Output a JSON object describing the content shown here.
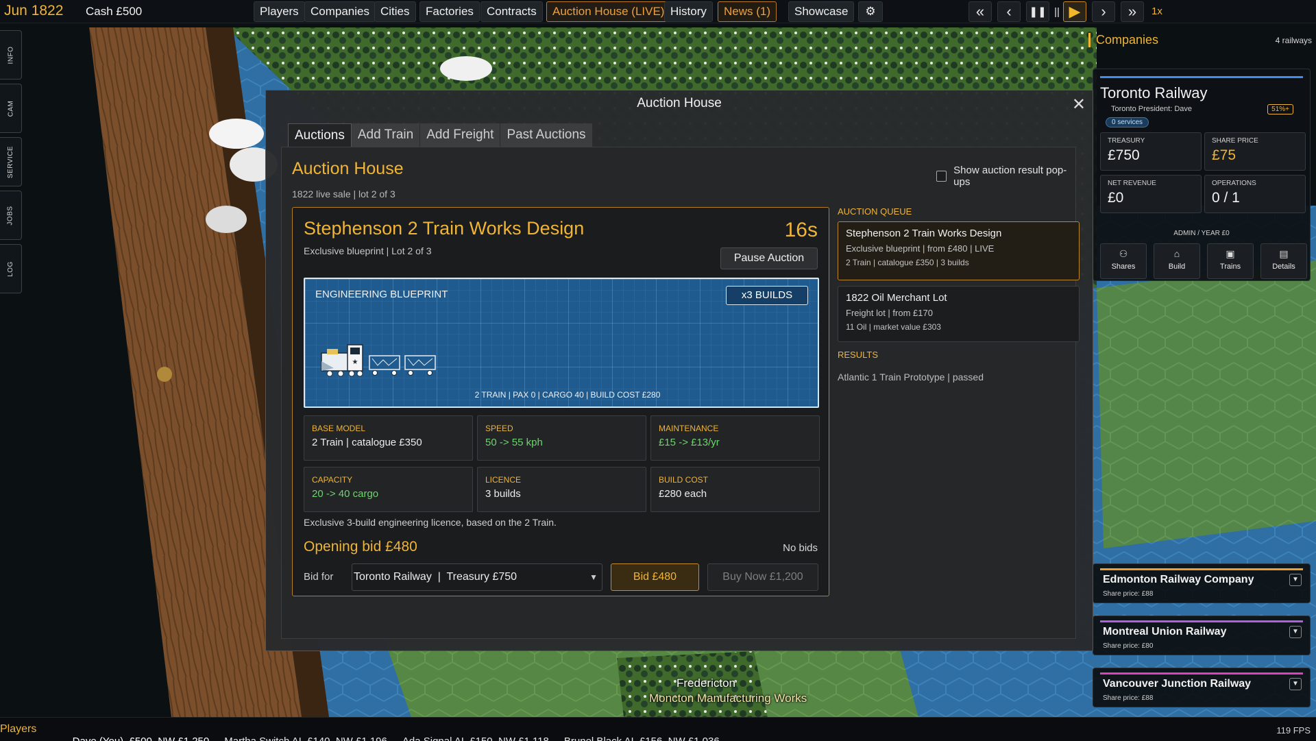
{
  "topbar": {
    "date": "Jun 1822",
    "cash": "Cash £500",
    "menu": [
      "Players",
      "Companies",
      "Cities",
      "Factories",
      "Contracts",
      "Auction House (LIVE)",
      "History",
      "News (1)",
      "Showcase"
    ],
    "speed": "1x"
  },
  "left_tabs": [
    "INFO",
    "CAM",
    "SERVICE",
    "JOBS",
    "LOG"
  ],
  "map_labels": {
    "city": "Fredericton",
    "works": "Moncton Manufacturing Works"
  },
  "modal": {
    "title": "Auction House",
    "close": "✕",
    "tabs": [
      "Auctions",
      "Add Train",
      "Add Freight",
      "Past Auctions"
    ],
    "heading": "Auction House",
    "subheading": "1822 live sale | lot 2 of 3",
    "popup_toggle_label": "Show auction result pop-ups",
    "lot": {
      "name": "Stephenson 2 Train Works Design",
      "meta": "Exclusive blueprint | Lot 2 of 3",
      "timer": "16s",
      "pause_label": "Pause Auction",
      "blueprint_label": "ENGINEERING BLUEPRINT",
      "builds_badge": "x3 BUILDS",
      "blueprint_stats": "2 TRAIN | PAX 0 | CARGO 40 | BUILD COST £280",
      "stats": [
        {
          "key": "Base Model",
          "value": "2 Train | catalogue £350",
          "green": false
        },
        {
          "key": "Speed",
          "value": "50 -> 55 kph",
          "green": true
        },
        {
          "key": "Maintenance",
          "value": "£15 -> £13/yr",
          "green": true
        },
        {
          "key": "Capacity",
          "value": "20 -> 40 cargo",
          "green": true
        },
        {
          "key": "Licence",
          "value": "3 builds",
          "green": false
        },
        {
          "key": "Build Cost",
          "value": "£280 each",
          "green": false
        }
      ],
      "description": "Exclusive 3-build engineering licence, based on the 2 Train.",
      "opening_bid": "Opening bid £480",
      "bids_status": "No bids",
      "bid_for_label": "Bid for",
      "bid_for_value": "Toronto Railway  |  Treasury £750",
      "bid_button": "Bid £480",
      "buy_now_button": "Buy Now £1,200"
    },
    "queue_label": "AUCTION QUEUE",
    "queue": [
      {
        "title": "Stephenson 2 Train Works Design",
        "line1": "Exclusive blueprint | from £480 | LIVE",
        "line2": "2 Train | catalogue £350 | 3 builds",
        "active": true
      },
      {
        "title": "1822 Oil Merchant Lot",
        "line1": "Freight lot | from £170",
        "line2": "11 Oil | market value £303",
        "active": false
      }
    ],
    "results_label": "RESULTS",
    "results": [
      "Atlantic 1 Train Prototype | passed"
    ]
  },
  "companies": {
    "heading": "Companies",
    "count": "4 railways",
    "selected": {
      "name": "Toronto Railway",
      "sub": "Toronto  President: Dave",
      "badge": "51%+",
      "services": "0 services",
      "treasury_label": "Treasury",
      "treasury": "£750",
      "share_price_label": "Share Price",
      "share_price": "£75",
      "net_revenue_label": "Net Revenue",
      "net_revenue": "£0",
      "operations_label": "Operations",
      "operations": "0 / 1",
      "admin": "ADMIN / YEAR   £0",
      "actions": [
        "Shares",
        "Build",
        "Trains",
        "Details"
      ]
    },
    "others": [
      {
        "name": "Edmonton Railway Company",
        "price": "Share price: £88",
        "color": "#f0a030"
      },
      {
        "name": "Montreal Union Railway",
        "price": "Share price: £80",
        "color": "#b060e0"
      },
      {
        "name": "Vancouver Junction Railway",
        "price": "Share price: £88",
        "color": "#e040c0"
      }
    ]
  },
  "bottombar": {
    "label": "Players",
    "players": [
      "Dave (You)  £500  NW £1,250",
      "Martha Switch AI  £140  NW £1,196",
      "Ada Signal AI  £150  NW £1,118",
      "Brunel Black AI  £156  NW £1,036"
    ],
    "fps": "119 FPS"
  }
}
